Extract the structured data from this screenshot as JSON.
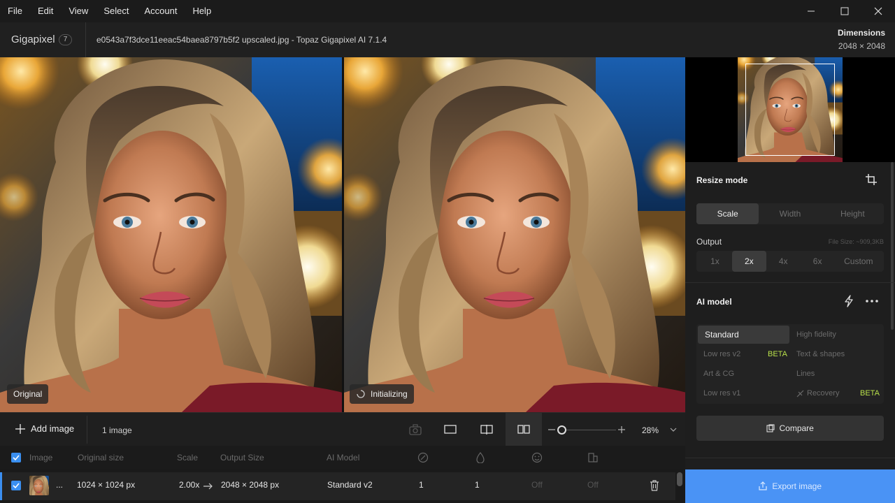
{
  "menu": [
    "File",
    "Edit",
    "View",
    "Select",
    "Account",
    "Help"
  ],
  "app": {
    "name": "Gigapixel",
    "badge": "7"
  },
  "file_title": "e0543a7f3dce11eeac54baea8797b5f2 upscaled.jpg - Topaz Gigapixel AI 7.1.4",
  "dimensions": {
    "label": "Dimensions",
    "value": "2048 × 2048"
  },
  "panes": {
    "left_label": "Original",
    "right_label": "Initializing"
  },
  "resize": {
    "title": "Resize mode",
    "modes": [
      "Scale",
      "Width",
      "Height"
    ],
    "output_label": "Output",
    "file_size": "File Size: ~909,3KB",
    "scales": [
      "1x",
      "2x",
      "4x",
      "6x",
      "Custom"
    ]
  },
  "ai_model": {
    "title": "AI model",
    "models": {
      "standard": "Standard",
      "high_fidelity": "High fidelity",
      "low_res_v2": "Low res v2",
      "text_shapes": "Text & shapes",
      "art_cg": "Art & CG",
      "lines": "Lines",
      "low_res_v1": "Low res v1",
      "recovery": "Recovery"
    },
    "beta": "BETA"
  },
  "compare_label": "Compare",
  "toolbar": {
    "add_image": "Add image",
    "image_count": "1 image",
    "zoom": "28%"
  },
  "table": {
    "headers": [
      "Image",
      "Original size",
      "Scale",
      "Output Size",
      "AI Model"
    ],
    "row": {
      "name": "...",
      "original_size": "1024 × 1024 px",
      "scale": "2.00x",
      "output_size": "2048 × 2048 px",
      "model": "Standard v2",
      "col1": "1",
      "col2": "1",
      "col3": "Off",
      "col4": "Off"
    }
  },
  "export_label": "Export image",
  "colors": {
    "accent": "#4a93f5",
    "beta": "#b8e04a",
    "checkbox": "#3a8ff0"
  }
}
